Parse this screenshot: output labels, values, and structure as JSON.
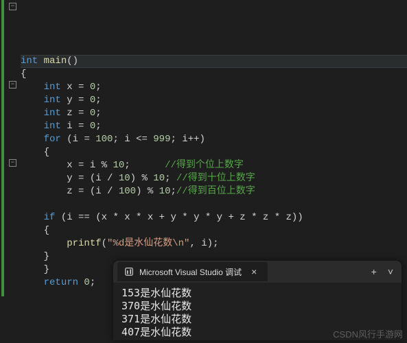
{
  "code": {
    "l1_int": "int",
    "l1_main": "main",
    "l1_paren": "()",
    "l2_brace": "{",
    "l3_int": "int",
    "l3_var": " x ",
    "l3_eq": "=",
    "l3_val": " 0",
    "l3_semi": ";",
    "l4_int": "int",
    "l4_var": " y ",
    "l4_eq": "=",
    "l4_val": " 0",
    "l4_semi": ";",
    "l5_int": "int",
    "l5_var": " z ",
    "l5_eq": "=",
    "l5_val": " 0",
    "l5_semi": ";",
    "l6_int": "int",
    "l6_var": " i ",
    "l6_eq": "=",
    "l6_val": " 0",
    "l6_semi": ";",
    "l7_for": "for",
    "l7_open": " (i ",
    "l7_eq1": "=",
    "l7_100": " 100",
    "l7_semi1": "; i ",
    "l7_le": "<=",
    "l7_999": " 999",
    "l7_semi2": "; i",
    "l7_pp": "++",
    "l7_close": ")",
    "l8_brace": "{",
    "l9_expr": "x ",
    "l9_eq": "=",
    "l9_rest": " i ",
    "l9_mod": "%",
    "l9_ten": " 10",
    "l9_semi": ";",
    "l9_cm": "//得到个位上数字",
    "l10_expr": "y ",
    "l10_eq": "=",
    "l10_rest": " (i ",
    "l10_div": "/",
    "l10_ten": " 10",
    "l10_paren": ") ",
    "l10_mod": "%",
    "l10_ten2": " 10",
    "l10_semi": "; ",
    "l10_cm": "//得到十位上数字",
    "l11_expr": "z ",
    "l11_eq": "=",
    "l11_rest": " (i ",
    "l11_div": "/",
    "l11_hund": " 100",
    "l11_paren": ") ",
    "l11_mod": "%",
    "l11_ten": " 10",
    "l11_semi": ";",
    "l11_cm": "//得到百位上数字",
    "l13_if": "if",
    "l13_open": " (i ",
    "l13_eqeq": "==",
    "l13_body": " (x * x * x + y * y * y + z * z * z))",
    "l14_brace": "{",
    "l15_printf": "printf",
    "l15_open": "(",
    "l15_str": "\"%d是水仙花数\\n\"",
    "l15_rest": ", i);",
    "l16_brace": "}",
    "l17_brace": "}",
    "l18_return": "return",
    "l18_val": " 0",
    "l18_semi": ";"
  },
  "fold": {
    "minus": "−",
    "minus2": "−",
    "minus3": "−"
  },
  "popup": {
    "title": "Microsoft Visual Studio 调试",
    "close": "×",
    "plus": "+",
    "more": "˅",
    "lines": {
      "l1": "153是水仙花数",
      "l2": "370是水仙花数",
      "l3": "371是水仙花数",
      "l4": "407是水仙花数"
    }
  },
  "watermark": "CSDN风行手游网"
}
